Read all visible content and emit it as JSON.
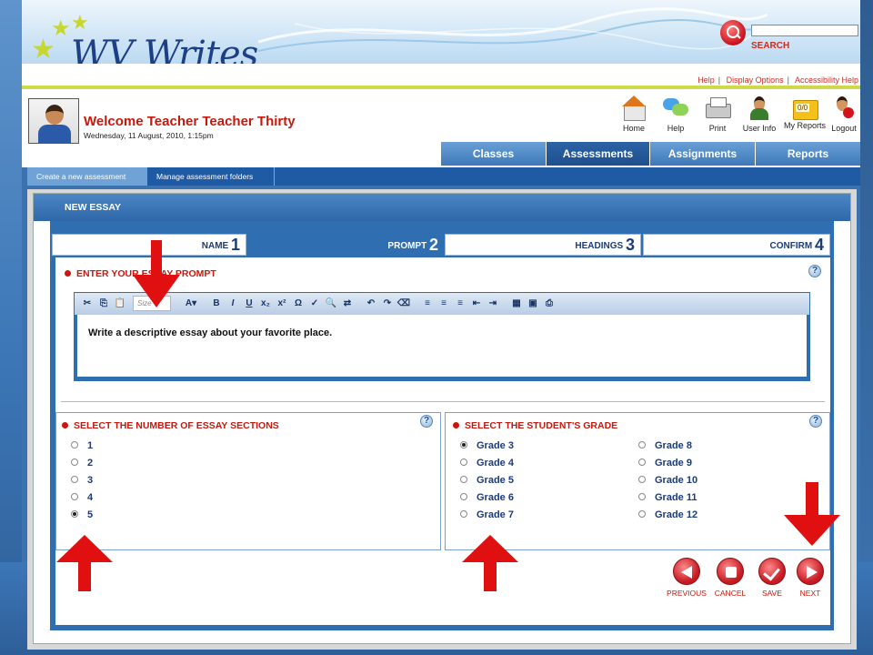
{
  "header": {
    "logo_text": "WV Writes",
    "search_label": "SEARCH",
    "search_placeholder": "",
    "util_links": [
      "Help",
      "Display Options",
      "Accessibility Help"
    ]
  },
  "user": {
    "welcome": "Welcome Teacher Teacher Thirty",
    "date": "Wednesday, 11 August, 2010, 1:15pm"
  },
  "top_nav": [
    {
      "label": "Home",
      "icon": "home-icon"
    },
    {
      "label": "Help",
      "icon": "chat-help-icon"
    },
    {
      "label": "Print",
      "icon": "printer-icon"
    },
    {
      "label": "User Info",
      "icon": "user-icon"
    },
    {
      "label": "My Reports",
      "icon": "reports-icon"
    },
    {
      "label": "Logout",
      "icon": "logout-icon"
    }
  ],
  "main_tabs": [
    "Classes",
    "Assessments",
    "Assignments",
    "Reports"
  ],
  "subnav": [
    "Create a new assessment",
    "Manage assessment folders"
  ],
  "panel": {
    "title": "NEW ESSAY",
    "steps": [
      {
        "label": "NAME",
        "num": "1"
      },
      {
        "label": "PROMPT",
        "num": "2"
      },
      {
        "label": "HEADINGS",
        "num": "3"
      },
      {
        "label": "CONFIRM",
        "num": "4"
      }
    ],
    "prompt_section_label": "ENTER YOUR ESSAY PROMPT",
    "size_placeholder": "Size",
    "prompt_text": "Write a descriptive essay about your favorite place.",
    "sections_label": "SELECT THE NUMBER OF ESSAY SECTIONS",
    "section_options": [
      "1",
      "2",
      "3",
      "4",
      "5"
    ],
    "section_selected": "5",
    "grade_label": "SELECT THE STUDENT'S GRADE",
    "grade_options_left": [
      "Grade 3",
      "Grade 4",
      "Grade 5",
      "Grade 6",
      "Grade 7"
    ],
    "grade_options_right": [
      "Grade 8",
      "Grade 9",
      "Grade 10",
      "Grade 11",
      "Grade 12"
    ],
    "grade_selected": "Grade 3",
    "help_glyph": "?"
  },
  "actions": [
    "PREVIOUS",
    "CANCEL",
    "SAVE",
    "NEXT"
  ],
  "colors": {
    "accent_red": "#c8180e",
    "nav_blue": "#2f6fb1",
    "brand_green": "#cfd84a",
    "annotation_red": "#e01010"
  }
}
